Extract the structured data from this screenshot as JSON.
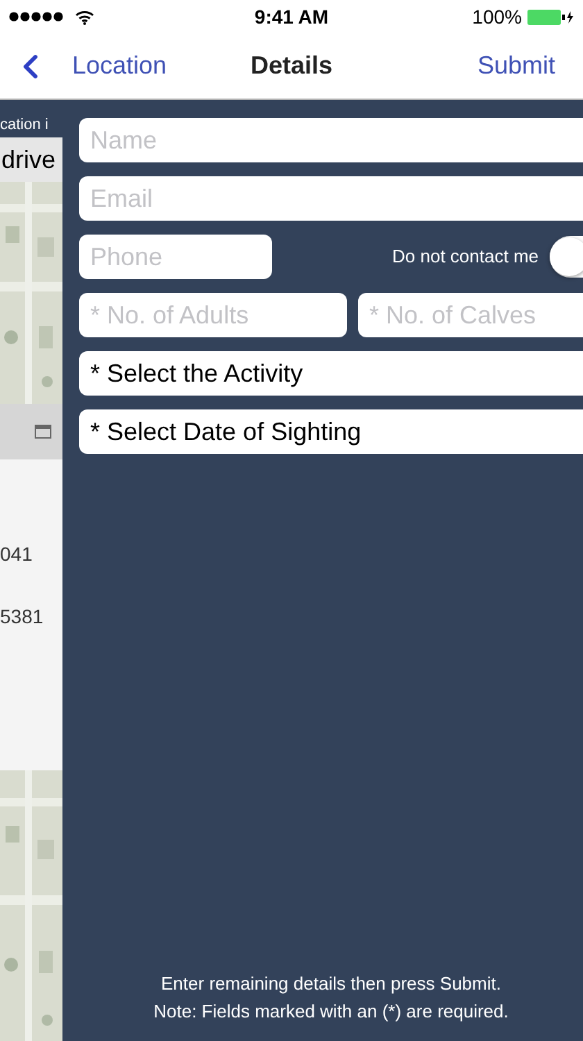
{
  "status_bar": {
    "time": "9:41 AM",
    "battery": "100%"
  },
  "nav": {
    "back": "Location",
    "title": "Details",
    "action": "Submit"
  },
  "background_page": {
    "header": "cation i",
    "button": "drive",
    "rows": [
      "041",
      "5381"
    ]
  },
  "form": {
    "name": {
      "placeholder": "Name"
    },
    "email": {
      "placeholder": "Email"
    },
    "phone": {
      "placeholder": "Phone"
    },
    "do_not_contact": {
      "label": "Do not contact me",
      "on": false
    },
    "adults": {
      "placeholder": "* No. of Adults"
    },
    "calves": {
      "placeholder": "* No. of Calves"
    },
    "activity": {
      "label": "* Select the Activity"
    },
    "date": {
      "label": "* Select Date of Sighting"
    }
  },
  "footer": [
    "Enter remaining details then press Submit.",
    "Note: Fields marked with an (*) are required."
  ]
}
